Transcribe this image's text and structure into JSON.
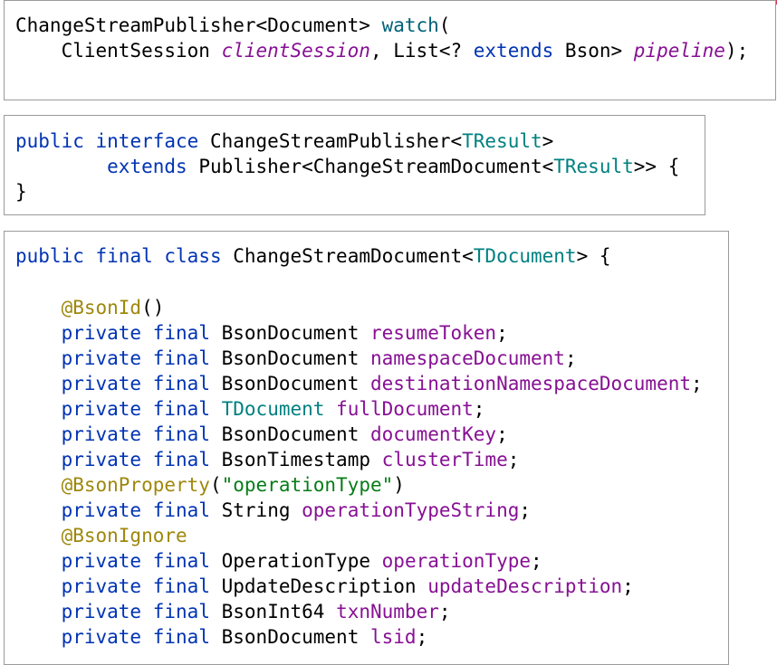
{
  "colors": {
    "keyword": "#0033b3",
    "method": "#00627a",
    "field": "#871094",
    "type_param": "#008080",
    "annotation": "#9e880d",
    "string": "#067d17",
    "border": "#9a9a9a",
    "corner_accent": "#d9365b"
  },
  "block1": {
    "l1": {
      "ret": "ChangeStreamPublisher<Document> ",
      "method": "watch",
      "open": "("
    },
    "l2": {
      "indent": "    ",
      "type1": "ClientSession ",
      "param1": "clientSession",
      "sep": ", List<? ",
      "ext": "extends",
      "bson": " Bson> ",
      "param2": "pipeline",
      "close": ");"
    }
  },
  "block2": {
    "l1": {
      "public": "public",
      "interface": "interface",
      "name": "ChangeStreamPublisher<",
      "tparam": "TResult",
      "close": ">"
    },
    "l2": {
      "indent": "        ",
      "extends": "extends",
      "pub": " Publisher<ChangeStreamDocument<",
      "tparam": "TResult",
      "close": ">> {"
    },
    "l3": {
      "brace": "}"
    }
  },
  "block3": {
    "header": {
      "public": "public",
      "final": "final",
      "class": "class",
      "name": "ChangeStreamDocument<",
      "tparam": "TDocument",
      "close": "> {"
    },
    "bson_id": {
      "ann": "@BsonId",
      "rest": "()"
    },
    "bson_property": {
      "ann": "@BsonProperty",
      "open": "(",
      "str": "\"operationType\"",
      "close": ")"
    },
    "bson_ignore": {
      "ann": "@BsonIgnore"
    },
    "mod_private": "private",
    "mod_final": "final",
    "fields": [
      {
        "type": "BsonDocument",
        "name": "resumeToken"
      },
      {
        "type": "BsonDocument",
        "name": "namespaceDocument"
      },
      {
        "type": "BsonDocument",
        "name": "destinationNamespaceDocument"
      },
      {
        "type": "TDocument",
        "name": "fullDocument"
      },
      {
        "type": "BsonDocument",
        "name": "documentKey"
      },
      {
        "type": "BsonTimestamp",
        "name": "clusterTime"
      },
      {
        "type": "String",
        "name": "operationTypeString"
      },
      {
        "type": "OperationType",
        "name": "operationType"
      },
      {
        "type": "UpdateDescription",
        "name": "updateDescription"
      },
      {
        "type": "BsonInt64",
        "name": "txnNumber"
      },
      {
        "type": "BsonDocument",
        "name": "lsid"
      }
    ]
  }
}
